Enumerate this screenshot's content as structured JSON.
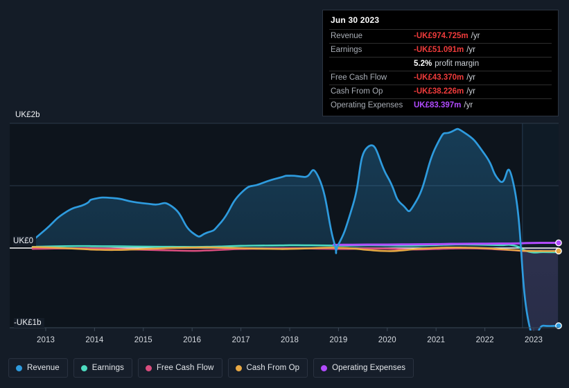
{
  "tooltip": {
    "date": "Jun 30 2023",
    "rows": [
      {
        "key": "Revenue",
        "value": "-UK£974.725m",
        "unit": "/yr",
        "color": "red"
      },
      {
        "key": "Earnings",
        "value": "-UK£51.091m",
        "unit": "/yr",
        "color": "red"
      },
      {
        "key": "",
        "value": "5.2%",
        "unit": "profit margin",
        "color": "white"
      },
      {
        "key": "Free Cash Flow",
        "value": "-UK£43.370m",
        "unit": "/yr",
        "color": "red"
      },
      {
        "key": "Cash From Op",
        "value": "-UK£38.226m",
        "unit": "/yr",
        "color": "red"
      },
      {
        "key": "Operating Expenses",
        "value": "UK£83.397m",
        "unit": "/yr",
        "color": "purple"
      }
    ]
  },
  "legend": {
    "items": [
      {
        "label": "Revenue",
        "color": "#2e9bde"
      },
      {
        "label": "Earnings",
        "color": "#4ddbc0"
      },
      {
        "label": "Free Cash Flow",
        "color": "#d94d7e"
      },
      {
        "label": "Cash From Op",
        "color": "#e8a844"
      },
      {
        "label": "Operating Expenses",
        "color": "#b14bff"
      }
    ]
  },
  "axes": {
    "y_top_label": "UK£2b",
    "y_zero_label": "UK£0",
    "y_bottom_label": "-UK£1b",
    "x_labels": [
      "2013",
      "2014",
      "2015",
      "2016",
      "2017",
      "2018",
      "2019",
      "2020",
      "2021",
      "2022",
      "2023"
    ]
  },
  "chart_data": {
    "type": "area",
    "title": "",
    "xlabel": "",
    "ylabel": "",
    "ylim": [
      -1000,
      2000
    ],
    "y_unit": "UK£ millions per year",
    "grid": true,
    "legend_position": "bottom",
    "x_tick_labels": [
      "2013",
      "2014",
      "2015",
      "2016",
      "2017",
      "2018",
      "2019",
      "2020",
      "2021",
      "2022",
      "2023"
    ],
    "x": [
      2012.73,
      2013.0,
      2013.4,
      2013.8,
      2014.0,
      2014.4,
      2014.8,
      2015.2,
      2015.6,
      2016.0,
      2016.3,
      2016.6,
      2017.0,
      2017.4,
      2017.8,
      2018.0,
      2018.3,
      2018.6,
      2018.9,
      2019.0,
      2019.3,
      2019.6,
      2020.0,
      2020.3,
      2020.6,
      2021.0,
      2021.3,
      2021.6,
      2022.0,
      2022.3,
      2022.6,
      2022.9,
      2023.2,
      2023.5
    ],
    "series": [
      {
        "name": "Revenue",
        "color": "#2e9bde",
        "filled": true,
        "values": [
          120,
          300,
          570,
          700,
          790,
          800,
          740,
          700,
          660,
          250,
          245,
          420,
          880,
          1030,
          1130,
          1160,
          1140,
          1120,
          120,
          60,
          700,
          1620,
          1150,
          700,
          760,
          1630,
          1860,
          1840,
          1500,
          1080,
          980,
          -940,
          -975,
          -975
        ]
      },
      {
        "name": "Earnings",
        "color": "#4ddbc0",
        "filled": false,
        "values": [
          20,
          25,
          30,
          32,
          30,
          28,
          25,
          22,
          20,
          18,
          20,
          25,
          35,
          40,
          42,
          45,
          44,
          43,
          40,
          38,
          40,
          45,
          42,
          38,
          40,
          48,
          55,
          58,
          52,
          46,
          40,
          -45,
          -51,
          -51
        ]
      },
      {
        "name": "Free Cash Flow",
        "color": "#d94d7e",
        "filled": false,
        "values": [
          -10,
          -8,
          -5,
          -3,
          -5,
          -10,
          -18,
          -25,
          -30,
          -35,
          -30,
          -22,
          -12,
          -8,
          -5,
          -3,
          -5,
          -8,
          -10,
          -12,
          -10,
          -5,
          -8,
          -15,
          -18,
          -12,
          -6,
          -4,
          -8,
          -18,
          -28,
          -40,
          -43,
          -43
        ]
      },
      {
        "name": "Cash From Op",
        "color": "#e8a844",
        "filled": false,
        "values": [
          15,
          10,
          -2,
          -14,
          -20,
          -24,
          -18,
          -8,
          2,
          8,
          10,
          6,
          -2,
          -8,
          -12,
          -10,
          -6,
          2,
          6,
          4,
          -6,
          -24,
          -38,
          -30,
          -12,
          2,
          8,
          6,
          -2,
          -14,
          -26,
          -36,
          -38,
          -38
        ]
      },
      {
        "name": "Operating Expenses",
        "color": "#b14bff",
        "filled": false,
        "start_x": 2018.88,
        "values": [
          null,
          null,
          null,
          null,
          null,
          null,
          null,
          null,
          null,
          null,
          null,
          null,
          null,
          null,
          null,
          null,
          null,
          null,
          52,
          52,
          53,
          55,
          56,
          58,
          60,
          62,
          66,
          68,
          70,
          72,
          74,
          80,
          83,
          83
        ]
      }
    ],
    "forecast_region": {
      "from_x": 2022.77,
      "to_x": 2023.78,
      "shaded": true
    },
    "end_markers": [
      {
        "series": "Operating Expenses",
        "value": 83
      },
      {
        "series": "Cash From Op",
        "value": -38
      },
      {
        "series": "Revenue",
        "value": -975
      }
    ]
  }
}
